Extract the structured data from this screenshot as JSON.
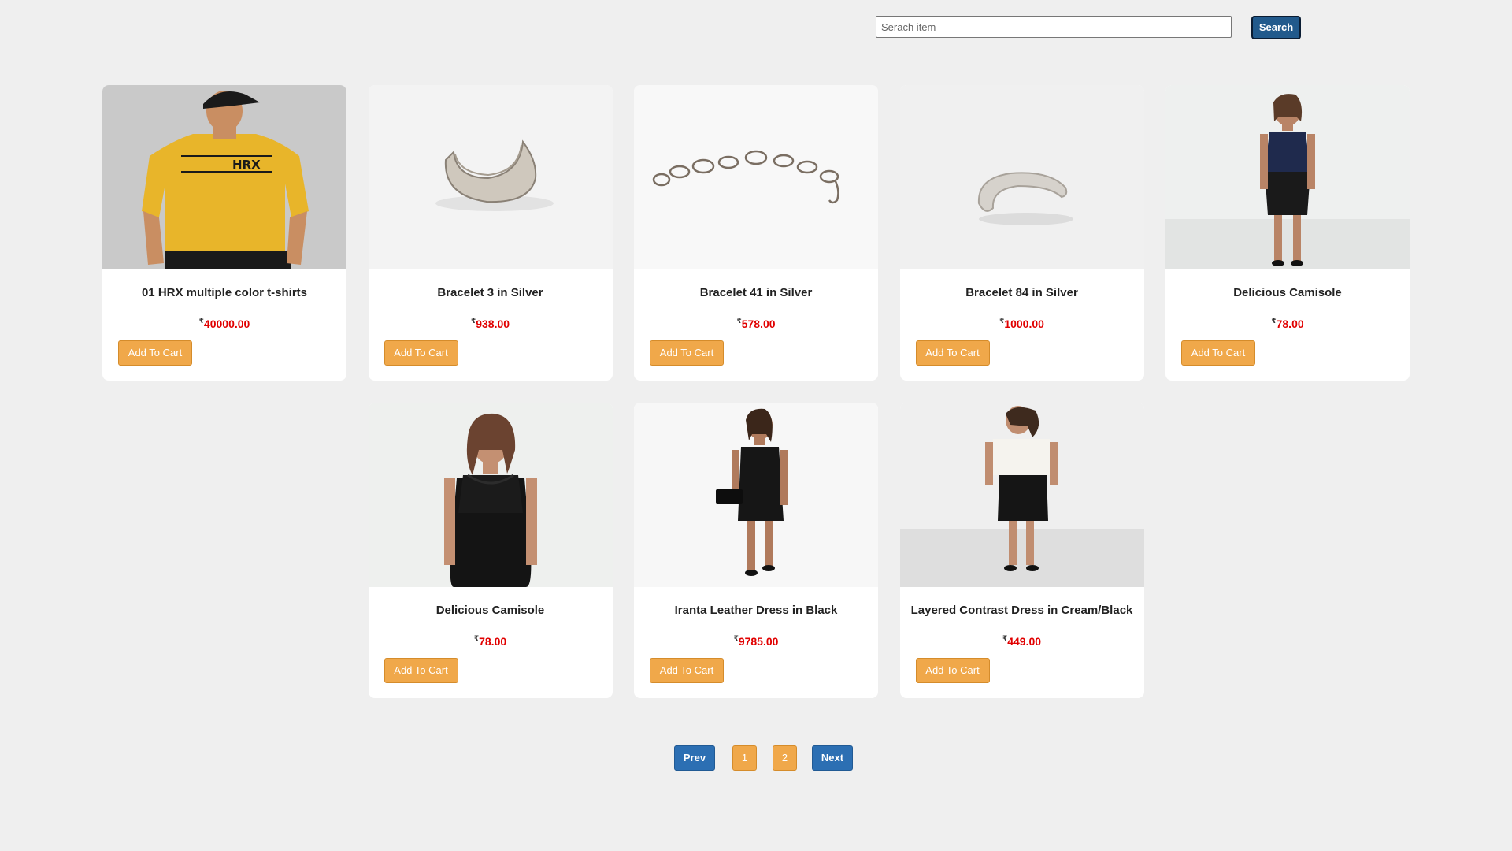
{
  "search": {
    "placeholder": "Serach item",
    "value": "",
    "button_label": "Search",
    "button_color": "#225a8c"
  },
  "currency_symbol": "₹",
  "colors": {
    "background": "#efefef",
    "price": "#e10000",
    "cart_button": "#f0a84a",
    "nav_button": "#2c6fb3"
  },
  "products": [
    {
      "title": "01 HRX multiple color t-shirts",
      "price": "40000.00",
      "cart_label": "Add To Cart",
      "image": "man-yellow-tshirt-photo"
    },
    {
      "title": "Bracelet 3 in Silver",
      "price": "938.00",
      "cart_label": "Add To Cart",
      "image": "silver-cuff-bracelet-photo"
    },
    {
      "title": "Bracelet 41 in Silver",
      "price": "578.00",
      "cart_label": "Add To Cart",
      "image": "silver-chain-bracelet-photo"
    },
    {
      "title": "Bracelet 84 in Silver",
      "price": "1000.00",
      "cart_label": "Add To Cart",
      "image": "silver-ring-bracelet-photo"
    },
    {
      "title": "Delicious Camisole",
      "price": "78.00",
      "cart_label": "Add To Cart",
      "image": "woman-navy-camisole-photo"
    },
    {
      "title": "Delicious Camisole",
      "price": "78.00",
      "cart_label": "Add To Cart",
      "image": "woman-black-camisole-dress-photo"
    },
    {
      "title": "Iranta Leather Dress in Black",
      "price": "9785.00",
      "cart_label": "Add To Cart",
      "image": "woman-black-leather-dress-photo"
    },
    {
      "title": "Layered Contrast Dress in Cream/Black",
      "price": "449.00",
      "cart_label": "Add To Cart",
      "image": "woman-cream-black-dress-photo"
    }
  ],
  "pagination": {
    "prev_label": "Prev",
    "pages": [
      "1",
      "2"
    ],
    "next_label": "Next"
  }
}
